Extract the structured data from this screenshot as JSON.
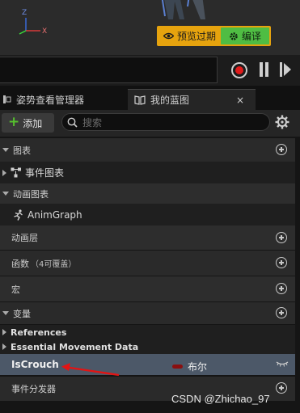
{
  "viewport": {
    "axis": {
      "z": "Z",
      "x": "X"
    },
    "status": {
      "preview_label": "预览过期",
      "compile_label": "编译"
    }
  },
  "tabs": {
    "pose_manager": "姿势查看管理器",
    "my_blueprint": "我的蓝图",
    "close_symbol": "×"
  },
  "toolbar": {
    "add_label": "添加",
    "search_placeholder": "搜索"
  },
  "rows": {
    "graphs": "图表",
    "event_graph": "事件图表",
    "anim_graphs": "动画图表",
    "anim_graph": "AnimGraph",
    "anim_layers": "动画层",
    "functions": "函数",
    "functions_note": "（4可覆盖）",
    "macros": "宏",
    "variables": "变量",
    "references": "References",
    "essential_movement": "Essential Movement Data",
    "iscrouch": "IsCrouch",
    "iscrouch_type": "布尔",
    "event_dispatchers": "事件分发器"
  },
  "watermark": "CSDN @Zhichao_97",
  "colors": {
    "accent_orange": "#e6a30e",
    "compile_green": "#4fbd43",
    "selection": "#4c5868",
    "bool_pin": "#8a0f0f",
    "arrow_red": "#e21414"
  }
}
